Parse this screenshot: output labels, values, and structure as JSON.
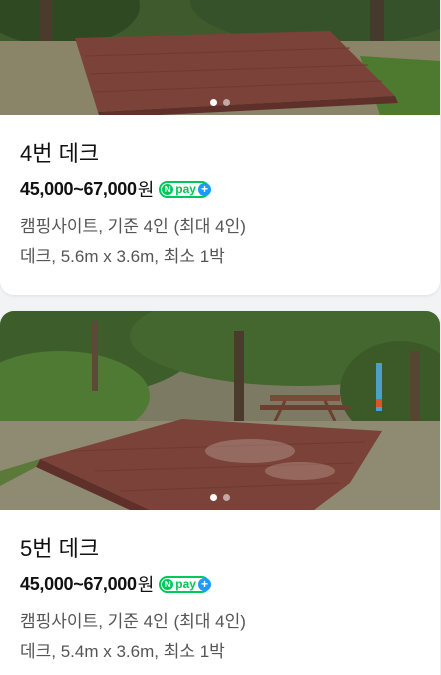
{
  "cards": [
    {
      "title": "4번 데크",
      "price": "45,000~67,000",
      "price_unit": "원",
      "pay_badge": {
        "n": "N",
        "label": "pay",
        "plus": "+"
      },
      "category": "캠핑사이트, 기준 4인 (최대 4인)",
      "details": "데크, 5.6m x 3.6m, 최소 1박",
      "photo_indicator": {
        "total": 2,
        "active": 1
      }
    },
    {
      "title": "5번 데크",
      "price": "45,000~67,000",
      "price_unit": "원",
      "pay_badge": {
        "n": "N",
        "label": "pay",
        "plus": "+"
      },
      "category": "캠핑사이트, 기준 4인 (최대 4인)",
      "details": "데크, 5.4m x 3.6m, 최소 1박",
      "photo_indicator": {
        "total": 2,
        "active": 1
      }
    }
  ],
  "colors": {
    "naver_pay_green": "#03c75a",
    "naver_pay_plus_blue": "#1a9bff",
    "deck_wood": "#7a4238"
  }
}
